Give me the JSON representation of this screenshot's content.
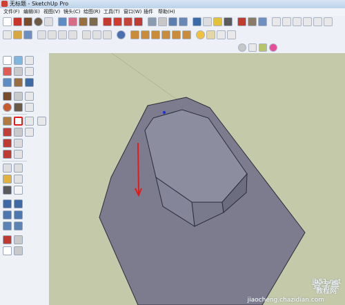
{
  "window": {
    "title": "无标题 - SketchUp Pro"
  },
  "menu": [
    "文件(F)",
    "编辑(E)",
    "视图(V)",
    "镜头(C)",
    "绘图(R)",
    "工具(T)",
    "窗口(W)",
    "插件",
    "帮助(H)"
  ],
  "watermark": {
    "line1": "查字典",
    "line2": "教程网",
    "site": "jb51.net",
    "url": "jiaocheng.chazidian.com"
  },
  "icons": {
    "app": "sketchup-app-icon",
    "highlighted_tool": "follow-me-tool-icon"
  },
  "colors": {
    "face": "#7c7c8e",
    "face_light": "#8d8da0",
    "face_dark": "#6d6d80",
    "edge": "#2b2b3a",
    "arrow": "#e21b1b",
    "highlight": "#e21b1b",
    "background": "#c4c9a9"
  }
}
